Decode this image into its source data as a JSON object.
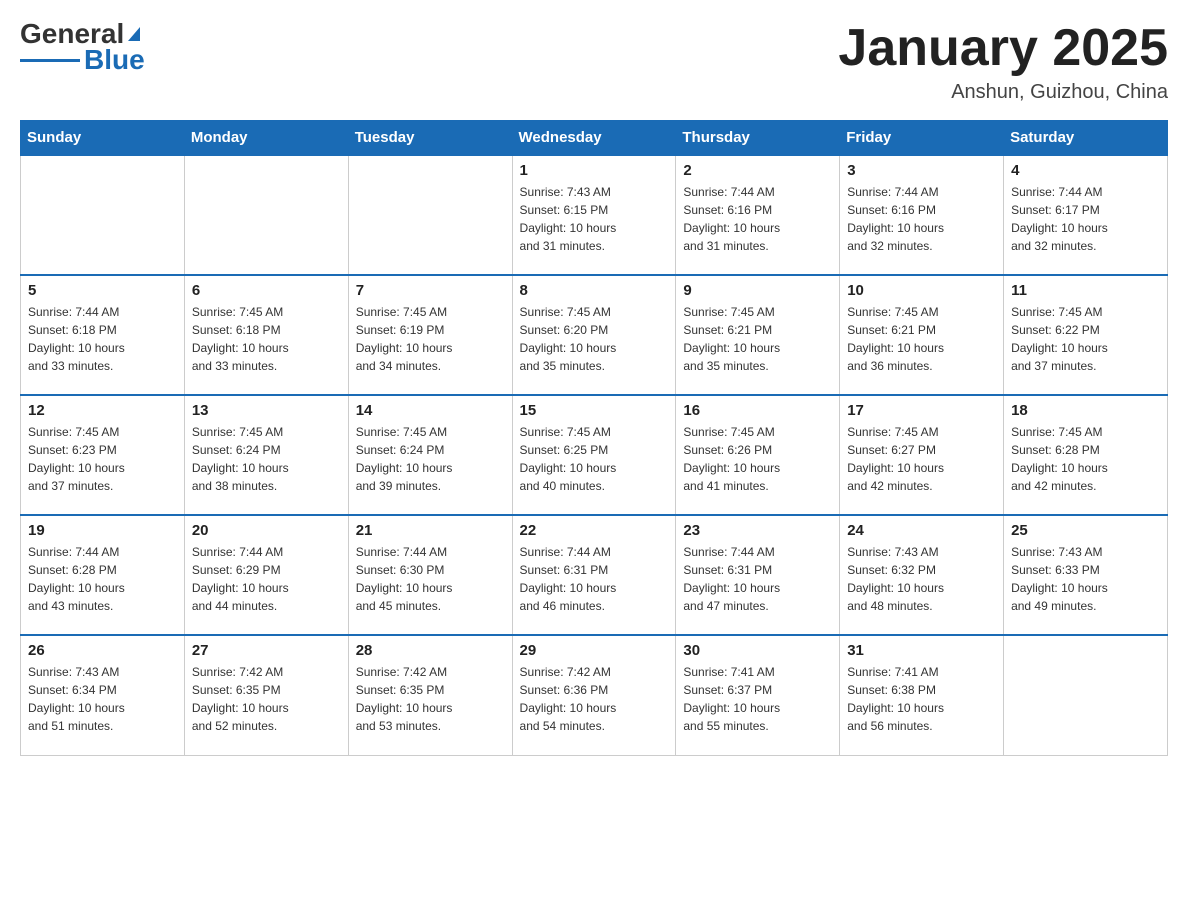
{
  "header": {
    "logo_general": "General",
    "logo_blue": "Blue",
    "title": "January 2025",
    "subtitle": "Anshun, Guizhou, China"
  },
  "days_of_week": [
    "Sunday",
    "Monday",
    "Tuesday",
    "Wednesday",
    "Thursday",
    "Friday",
    "Saturday"
  ],
  "weeks": [
    [
      {
        "day": "",
        "info": ""
      },
      {
        "day": "",
        "info": ""
      },
      {
        "day": "",
        "info": ""
      },
      {
        "day": "1",
        "info": "Sunrise: 7:43 AM\nSunset: 6:15 PM\nDaylight: 10 hours\nand 31 minutes."
      },
      {
        "day": "2",
        "info": "Sunrise: 7:44 AM\nSunset: 6:16 PM\nDaylight: 10 hours\nand 31 minutes."
      },
      {
        "day": "3",
        "info": "Sunrise: 7:44 AM\nSunset: 6:16 PM\nDaylight: 10 hours\nand 32 minutes."
      },
      {
        "day": "4",
        "info": "Sunrise: 7:44 AM\nSunset: 6:17 PM\nDaylight: 10 hours\nand 32 minutes."
      }
    ],
    [
      {
        "day": "5",
        "info": "Sunrise: 7:44 AM\nSunset: 6:18 PM\nDaylight: 10 hours\nand 33 minutes."
      },
      {
        "day": "6",
        "info": "Sunrise: 7:45 AM\nSunset: 6:18 PM\nDaylight: 10 hours\nand 33 minutes."
      },
      {
        "day": "7",
        "info": "Sunrise: 7:45 AM\nSunset: 6:19 PM\nDaylight: 10 hours\nand 34 minutes."
      },
      {
        "day": "8",
        "info": "Sunrise: 7:45 AM\nSunset: 6:20 PM\nDaylight: 10 hours\nand 35 minutes."
      },
      {
        "day": "9",
        "info": "Sunrise: 7:45 AM\nSunset: 6:21 PM\nDaylight: 10 hours\nand 35 minutes."
      },
      {
        "day": "10",
        "info": "Sunrise: 7:45 AM\nSunset: 6:21 PM\nDaylight: 10 hours\nand 36 minutes."
      },
      {
        "day": "11",
        "info": "Sunrise: 7:45 AM\nSunset: 6:22 PM\nDaylight: 10 hours\nand 37 minutes."
      }
    ],
    [
      {
        "day": "12",
        "info": "Sunrise: 7:45 AM\nSunset: 6:23 PM\nDaylight: 10 hours\nand 37 minutes."
      },
      {
        "day": "13",
        "info": "Sunrise: 7:45 AM\nSunset: 6:24 PM\nDaylight: 10 hours\nand 38 minutes."
      },
      {
        "day": "14",
        "info": "Sunrise: 7:45 AM\nSunset: 6:24 PM\nDaylight: 10 hours\nand 39 minutes."
      },
      {
        "day": "15",
        "info": "Sunrise: 7:45 AM\nSunset: 6:25 PM\nDaylight: 10 hours\nand 40 minutes."
      },
      {
        "day": "16",
        "info": "Sunrise: 7:45 AM\nSunset: 6:26 PM\nDaylight: 10 hours\nand 41 minutes."
      },
      {
        "day": "17",
        "info": "Sunrise: 7:45 AM\nSunset: 6:27 PM\nDaylight: 10 hours\nand 42 minutes."
      },
      {
        "day": "18",
        "info": "Sunrise: 7:45 AM\nSunset: 6:28 PM\nDaylight: 10 hours\nand 42 minutes."
      }
    ],
    [
      {
        "day": "19",
        "info": "Sunrise: 7:44 AM\nSunset: 6:28 PM\nDaylight: 10 hours\nand 43 minutes."
      },
      {
        "day": "20",
        "info": "Sunrise: 7:44 AM\nSunset: 6:29 PM\nDaylight: 10 hours\nand 44 minutes."
      },
      {
        "day": "21",
        "info": "Sunrise: 7:44 AM\nSunset: 6:30 PM\nDaylight: 10 hours\nand 45 minutes."
      },
      {
        "day": "22",
        "info": "Sunrise: 7:44 AM\nSunset: 6:31 PM\nDaylight: 10 hours\nand 46 minutes."
      },
      {
        "day": "23",
        "info": "Sunrise: 7:44 AM\nSunset: 6:31 PM\nDaylight: 10 hours\nand 47 minutes."
      },
      {
        "day": "24",
        "info": "Sunrise: 7:43 AM\nSunset: 6:32 PM\nDaylight: 10 hours\nand 48 minutes."
      },
      {
        "day": "25",
        "info": "Sunrise: 7:43 AM\nSunset: 6:33 PM\nDaylight: 10 hours\nand 49 minutes."
      }
    ],
    [
      {
        "day": "26",
        "info": "Sunrise: 7:43 AM\nSunset: 6:34 PM\nDaylight: 10 hours\nand 51 minutes."
      },
      {
        "day": "27",
        "info": "Sunrise: 7:42 AM\nSunset: 6:35 PM\nDaylight: 10 hours\nand 52 minutes."
      },
      {
        "day": "28",
        "info": "Sunrise: 7:42 AM\nSunset: 6:35 PM\nDaylight: 10 hours\nand 53 minutes."
      },
      {
        "day": "29",
        "info": "Sunrise: 7:42 AM\nSunset: 6:36 PM\nDaylight: 10 hours\nand 54 minutes."
      },
      {
        "day": "30",
        "info": "Sunrise: 7:41 AM\nSunset: 6:37 PM\nDaylight: 10 hours\nand 55 minutes."
      },
      {
        "day": "31",
        "info": "Sunrise: 7:41 AM\nSunset: 6:38 PM\nDaylight: 10 hours\nand 56 minutes."
      },
      {
        "day": "",
        "info": ""
      }
    ]
  ]
}
